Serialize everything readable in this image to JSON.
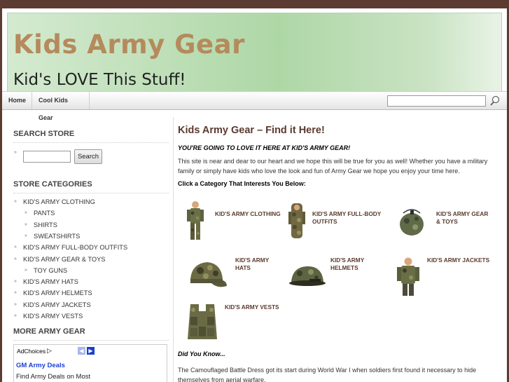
{
  "header": {
    "site_title": "Kids Army Gear",
    "site_description": "Kid's LOVE This Stuff!"
  },
  "nav": {
    "home": "Home",
    "cool_kids_gear": "Cool Kids Gear",
    "search_placeholder": ""
  },
  "sidebar": {
    "search_heading": "SEARCH STORE",
    "search_button": "Search",
    "categories_heading": "STORE CATEGORIES",
    "categories": [
      {
        "label": "KID'S ARMY CLOTHING",
        "level": 0
      },
      {
        "label": "PANTS",
        "level": 1
      },
      {
        "label": "SHIRTS",
        "level": 1
      },
      {
        "label": "SWEATSHIRTS",
        "level": 1
      },
      {
        "label": "KID'S ARMY FULL-BODY OUTFITS",
        "level": 0
      },
      {
        "label": "KID'S ARMY GEAR & TOYS",
        "level": 0
      },
      {
        "label": "TOY GUNS",
        "level": 1
      },
      {
        "label": "KID'S ARMY HATS",
        "level": 0
      },
      {
        "label": "KID'S ARMY HELMETS",
        "level": 0
      },
      {
        "label": "KID'S ARMY JACKETS",
        "level": 0
      },
      {
        "label": "KID'S ARMY VESTS",
        "level": 0
      }
    ],
    "more_heading": "MORE ARMY GEAR",
    "ad": {
      "adchoices": "AdChoices",
      "link": "GM Army Deals",
      "text": "Find Army Deals on Most"
    }
  },
  "main": {
    "title": "Kids Army Gear – Find it Here!",
    "tagline": "YOU'RE GOING TO LOVE IT HERE AT KID'S ARMY GEAR!",
    "intro": "This site is near and dear to our heart and we hope this will be true for you as well! Whether you have a military family or simply have kids who love the look and fun of Army Gear we hope you enjoy your time here.",
    "click_heading": "Click a Category That Interests You Below:",
    "products": [
      {
        "label": "KID'S ARMY CLOTHING"
      },
      {
        "label": "KID'S ARMY FULL-BODY OUTFITS"
      },
      {
        "label": "KID'S ARMY GEAR & TOYS"
      },
      {
        "label": "KID'S ARMY HATS"
      },
      {
        "label": "KID'S ARMY HELMETS"
      },
      {
        "label": "KID'S ARMY JACKETS"
      },
      {
        "label": "KID'S ARMY VESTS"
      }
    ],
    "did_you_know": "Did You Know...",
    "fact": "The Camouflaged Battle Dress got its start during World War I when soldiers first found it necessary to hide themselves from aerial warfare."
  },
  "colors": {
    "background": "#5c3b32",
    "title_tan": "#b58a5c",
    "heading_brown": "#5b3a2e",
    "link_blue": "#1a3fd0"
  }
}
